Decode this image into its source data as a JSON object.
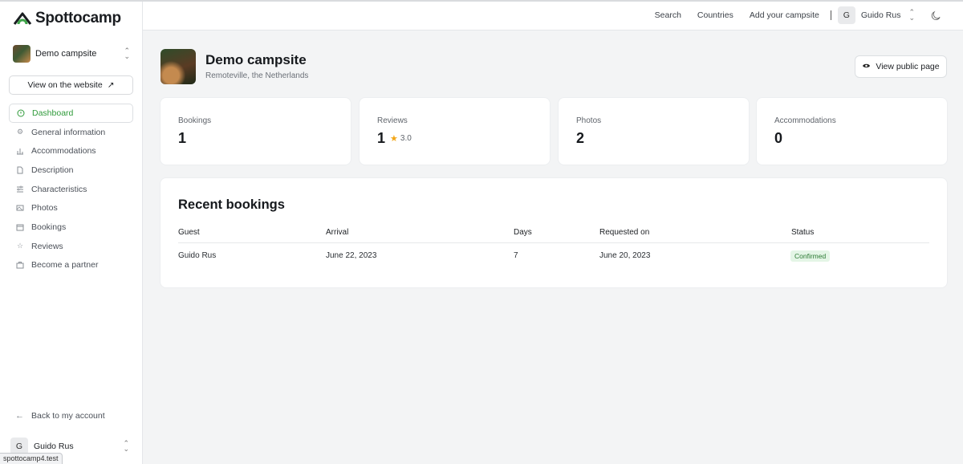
{
  "app": {
    "logo_text": "Spottocamp"
  },
  "sidebar": {
    "campsite_name": "Demo campsite",
    "view_website_label": "View on the website",
    "items": [
      {
        "label": "Dashboard",
        "icon": "dashboard-icon",
        "active": true
      },
      {
        "label": "General information",
        "icon": "gear-icon"
      },
      {
        "label": "Accommodations",
        "icon": "chart-icon"
      },
      {
        "label": "Description",
        "icon": "document-icon"
      },
      {
        "label": "Characteristics",
        "icon": "sliders-icon"
      },
      {
        "label": "Photos",
        "icon": "image-icon"
      },
      {
        "label": "Bookings",
        "icon": "calendar-icon"
      },
      {
        "label": "Reviews",
        "icon": "star-icon"
      },
      {
        "label": "Become a partner",
        "icon": "bag-icon"
      }
    ],
    "back_label": "Back to my account",
    "user_initial": "G",
    "user_name": "Guido Rus"
  },
  "status_bar_url": "spottocamp4.test",
  "topbar": {
    "links": [
      "Search",
      "Countries",
      "Add your campsite"
    ],
    "user_initial": "G",
    "user_name": "Guido Rus"
  },
  "header": {
    "title": "Demo campsite",
    "subtitle": "Remoteville, the Netherlands",
    "public_button": "View public page"
  },
  "stats": [
    {
      "label": "Bookings",
      "value": "1"
    },
    {
      "label": "Reviews",
      "value": "1",
      "rating": "3.0"
    },
    {
      "label": "Photos",
      "value": "2"
    },
    {
      "label": "Accommodations",
      "value": "0"
    }
  ],
  "recent_bookings": {
    "title": "Recent bookings",
    "columns": [
      "Guest",
      "Arrival",
      "Days",
      "Requested on",
      "Status"
    ],
    "rows": [
      {
        "guest": "Guido Rus",
        "arrival": "June 22, 2023",
        "days": "7",
        "requested_on": "June 20, 2023",
        "status": "Confirmed"
      }
    ]
  },
  "colors": {
    "accent_green": "#2f9a3a",
    "star": "#f2a516",
    "badge_bg": "#e4f5e6"
  }
}
